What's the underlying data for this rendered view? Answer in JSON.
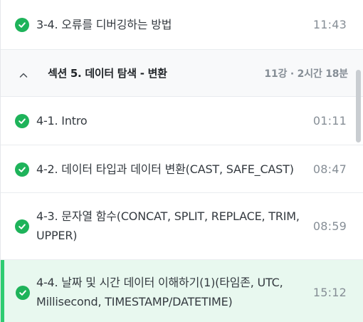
{
  "colors": {
    "check": "#1eb35a",
    "active_bg": "#e8f8ef",
    "active_border": "#2ecc71"
  },
  "top_lecture": {
    "title": "3-4. 오류를 디버깅하는 방법",
    "duration": "11:43",
    "icon": "check-circle-icon"
  },
  "section": {
    "title": "섹션 5. 데이터 탐색 - 변환",
    "meta": "11강 · 2시간 18분",
    "icon": "chevron-up-icon"
  },
  "lectures": [
    {
      "title": "4-1. Intro",
      "duration": "01:11"
    },
    {
      "title": "4-2. 데이터 타입과 데이터 변환(CAST, SAFE_CAST)",
      "duration": "08:47"
    },
    {
      "title": "4-3. 문자열 함수(CONCAT, SPLIT, REPLACE, TRIM, UPPER)",
      "duration": "08:59"
    },
    {
      "title": "4-4. 날짜 및 시간 데이터 이해하기(1)(타임존, UTC, Millisecond, TIMESTAMP/DATETIME)",
      "duration": "15:12",
      "active": true
    }
  ]
}
